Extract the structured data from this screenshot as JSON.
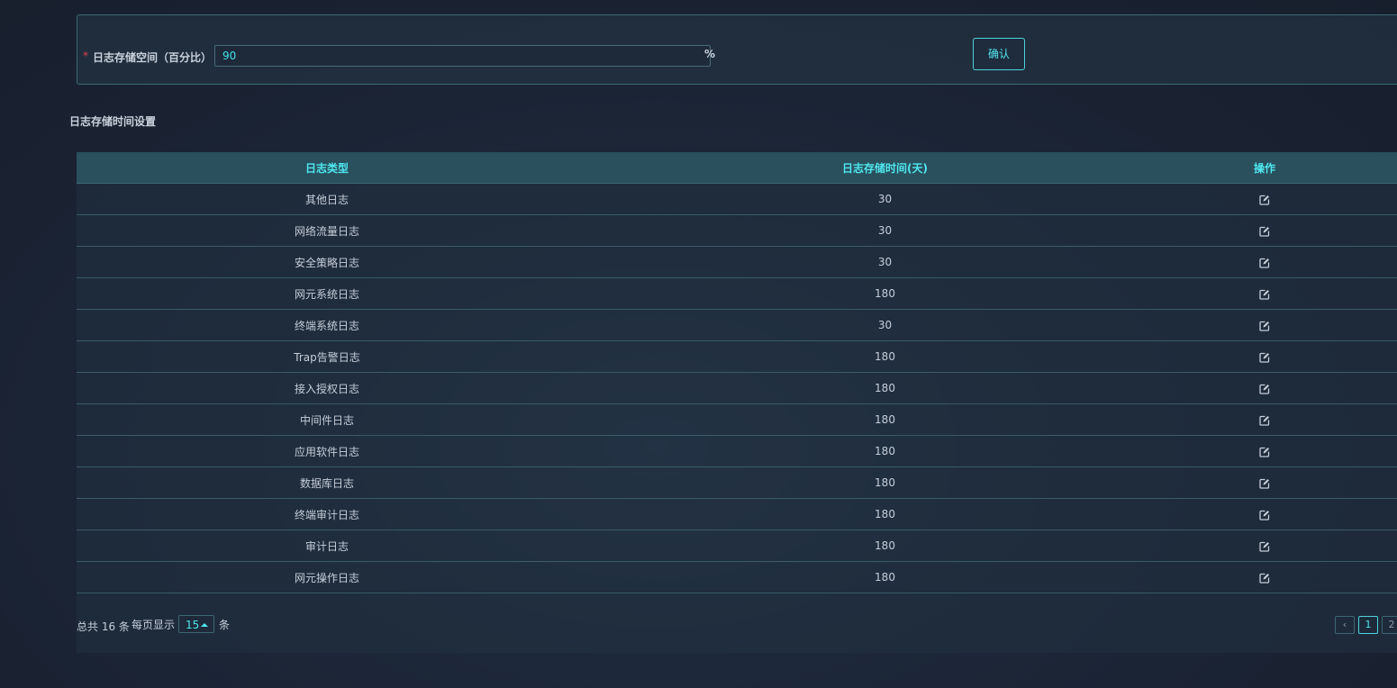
{
  "storage": {
    "required_mark": "*",
    "label": "日志存储空间（百分比）",
    "value": "90",
    "unit": "%",
    "confirm_label": "确认"
  },
  "section_title": "日志存储时间设置",
  "table": {
    "headers": [
      "日志类型",
      "日志存储时间(天)",
      "操作"
    ],
    "rows": [
      {
        "type": "其他日志",
        "days": "30"
      },
      {
        "type": "网络流量日志",
        "days": "30"
      },
      {
        "type": "安全策略日志",
        "days": "30"
      },
      {
        "type": "网元系统日志",
        "days": "180"
      },
      {
        "type": "终端系统日志",
        "days": "30"
      },
      {
        "type": "Trap告警日志",
        "days": "180"
      },
      {
        "type": "接入授权日志",
        "days": "180"
      },
      {
        "type": "中间件日志",
        "days": "180"
      },
      {
        "type": "应用软件日志",
        "days": "180"
      },
      {
        "type": "数据库日志",
        "days": "180"
      },
      {
        "type": "终端审计日志",
        "days": "180"
      },
      {
        "type": "审计日志",
        "days": "180"
      },
      {
        "type": "网元操作日志",
        "days": "180"
      }
    ],
    "action_icon": "edit-icon"
  },
  "pagination": {
    "total_text": "总共 16 条",
    "per_page_label": "每页显示",
    "per_page_value": "15",
    "per_page_unit": "条",
    "prev_label": "‹",
    "pages": [
      "1",
      "2"
    ],
    "current_page": "1"
  },
  "colors": {
    "accent": "#4fe7f0",
    "border": "#3a6b73",
    "header_bg": "#29505c",
    "required": "#e0414a"
  }
}
